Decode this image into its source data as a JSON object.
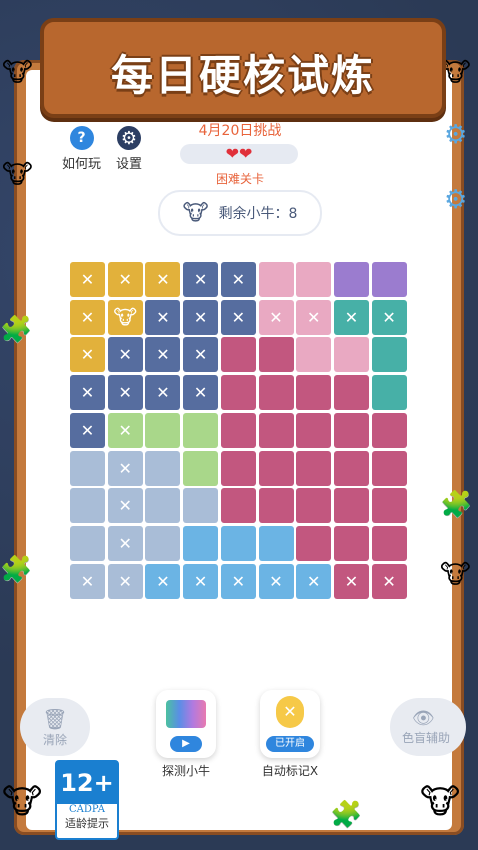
{
  "header": {
    "title": "每日硬核试炼"
  },
  "toolbar": {
    "help_label": "如何玩",
    "help_icon": "?",
    "settings_label": "设置"
  },
  "challenge": {
    "date": "4月20日挑战",
    "lives": "❤❤",
    "difficulty": "困难关卡",
    "remaining_label": "剩余小牛：8"
  },
  "colors": {
    "Y": "#e2b13b",
    "B": "#566d9f",
    "P": "#e9a9c2",
    "V": "#9b7ccf",
    "T": "#47b0a7",
    "M": "#c2577f",
    "G": "#a9d78a",
    "L": "#a9bdd7",
    "S": "#6bb4e4"
  },
  "grid": {
    "colors": [
      [
        "Y",
        "Y",
        "Y",
        "B",
        "B",
        "P",
        "P",
        "V",
        "V"
      ],
      [
        "Y",
        "Y",
        "B",
        "B",
        "B",
        "P",
        "P",
        "T",
        "T"
      ],
      [
        "Y",
        "B",
        "B",
        "B",
        "M",
        "M",
        "P",
        "P",
        "T"
      ],
      [
        "B",
        "B",
        "B",
        "B",
        "M",
        "M",
        "M",
        "M",
        "T"
      ],
      [
        "B",
        "G",
        "G",
        "G",
        "M",
        "M",
        "M",
        "M",
        "M"
      ],
      [
        "L",
        "L",
        "L",
        "G",
        "M",
        "M",
        "M",
        "M",
        "M"
      ],
      [
        "L",
        "L",
        "L",
        "L",
        "M",
        "M",
        "M",
        "M",
        "M"
      ],
      [
        "L",
        "L",
        "L",
        "S",
        "S",
        "S",
        "M",
        "M",
        "M"
      ],
      [
        "L",
        "L",
        "S",
        "S",
        "S",
        "S",
        "S",
        "M",
        "M"
      ]
    ],
    "marks": [
      [
        "x",
        "x",
        "x",
        "x",
        "x",
        "",
        "",
        "",
        ""
      ],
      [
        "x",
        "cow",
        "x",
        "x",
        "x",
        "x",
        "x",
        "x",
        "x"
      ],
      [
        "x",
        "x",
        "x",
        "x",
        "",
        "",
        "",
        "",
        ""
      ],
      [
        "x",
        "x",
        "x",
        "x",
        "",
        "",
        "",
        "",
        ""
      ],
      [
        "x",
        "x",
        "",
        "",
        "",
        "",
        "",
        "",
        ""
      ],
      [
        "",
        "x",
        "",
        "",
        "",
        "",
        "",
        "",
        ""
      ],
      [
        "",
        "x",
        "",
        "",
        "",
        "",
        "",
        "",
        ""
      ],
      [
        "",
        "x",
        "",
        "",
        "",
        "",
        "",
        "",
        ""
      ],
      [
        "x",
        "x",
        "x",
        "x",
        "x",
        "x",
        "x",
        "x",
        "x"
      ]
    ]
  },
  "bottom": {
    "clear_label": "清除",
    "detect_label": "探测小牛",
    "auto_badge": "已开启",
    "auto_label": "自动标记X",
    "colorblind_label": "色盲辅助"
  },
  "age_rating": {
    "number": "12+",
    "org": "CADPA",
    "caption": "适龄提示"
  }
}
